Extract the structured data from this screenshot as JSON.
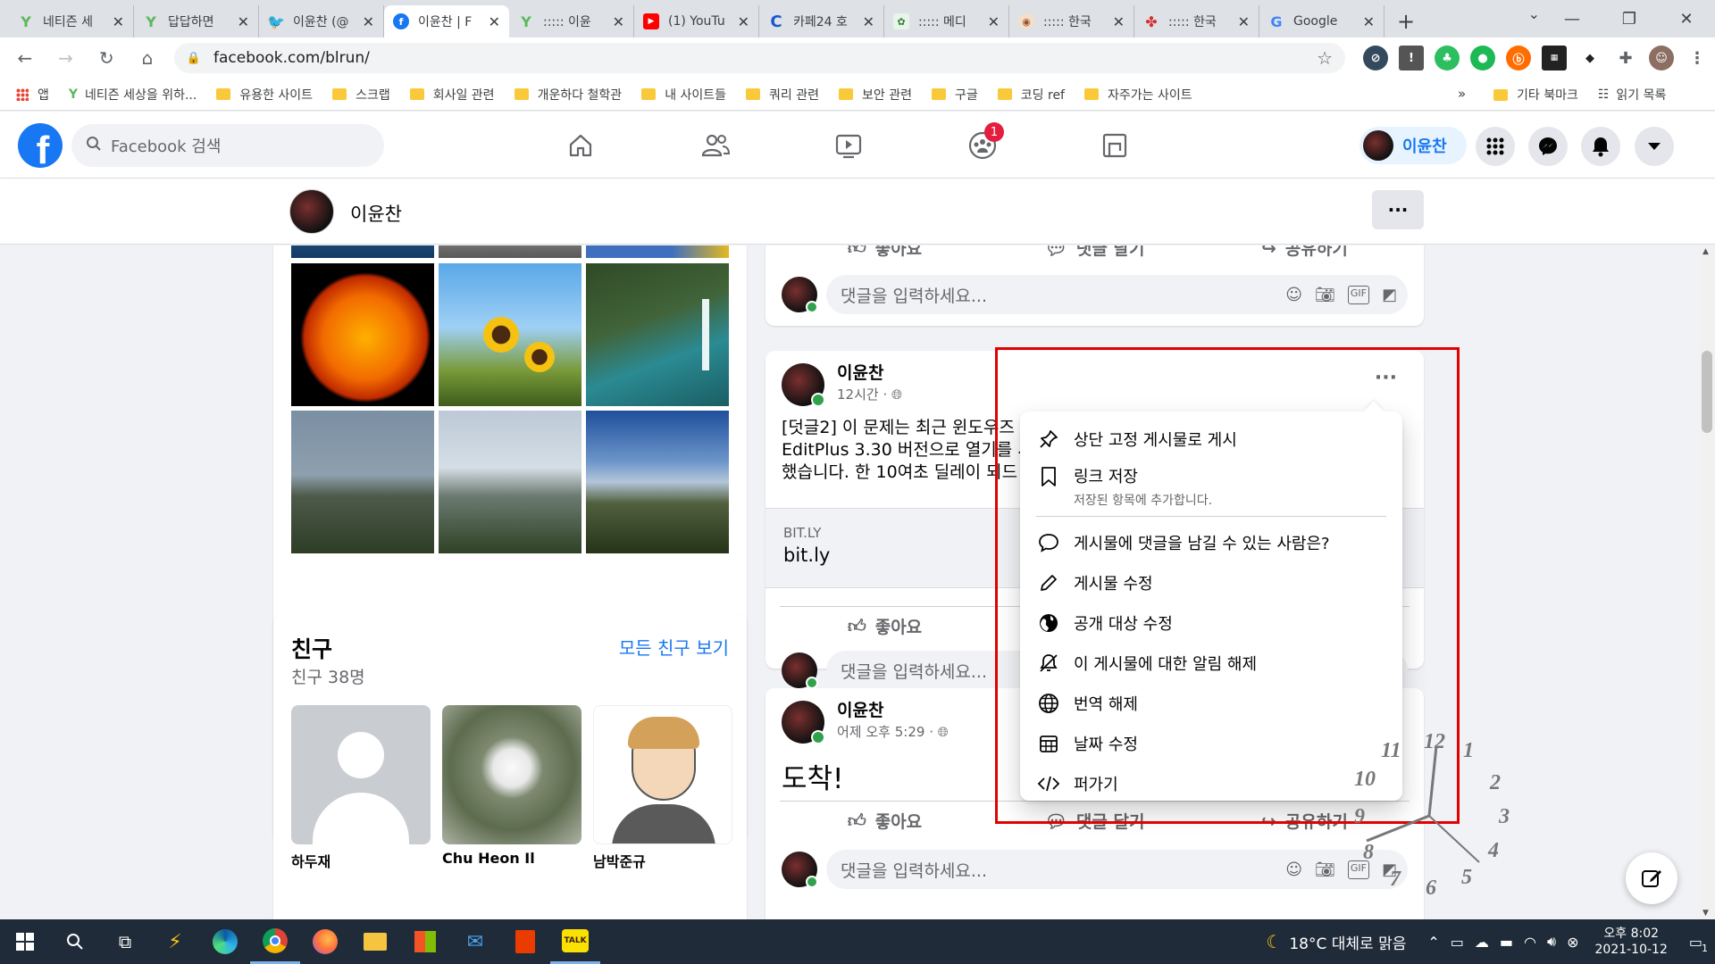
{
  "browser": {
    "tabs": [
      {
        "label": "네티즌 세",
        "icon": "sprout",
        "color": "#5cb85c",
        "active": false
      },
      {
        "label": "답답하면",
        "icon": "sprout",
        "color": "#5cb85c",
        "active": false
      },
      {
        "label": "이윤찬 (@",
        "icon": "twitter",
        "color": "#1da1f2",
        "active": false
      },
      {
        "label": "이윤찬 | F",
        "icon": "facebook",
        "color": "#1877f2",
        "active": true
      },
      {
        "label": "::::: 이윤",
        "icon": "sprout",
        "color": "#5cb85c",
        "active": false
      },
      {
        "label": "(1) YouTu",
        "icon": "youtube",
        "color": "#ff0000",
        "active": false
      },
      {
        "label": "카페24 호",
        "icon": "cafe24",
        "color": "#1a57d6",
        "active": false
      },
      {
        "label": "::::: 메디",
        "icon": "medi",
        "color": "#2e7d32",
        "active": false
      },
      {
        "label": "::::: 한국",
        "icon": "korea",
        "color": "#a0522d",
        "active": false
      },
      {
        "label": "::::: 한국",
        "icon": "korea2",
        "color": "#d32f2f",
        "active": false
      },
      {
        "label": "Google",
        "icon": "google",
        "color": "#4285f4",
        "active": false
      }
    ],
    "url": "facebook.com/blrun/",
    "bookmarks": [
      {
        "label": "앱",
        "type": "apps"
      },
      {
        "label": "네티즌 세상을 위하...",
        "type": "sprout"
      },
      {
        "label": "유용한 사이트",
        "type": "folder"
      },
      {
        "label": "스크랩",
        "type": "folder"
      },
      {
        "label": "회사일 관련",
        "type": "folder"
      },
      {
        "label": "개운하다 철학관",
        "type": "folder"
      },
      {
        "label": "내 사이트들",
        "type": "folder"
      },
      {
        "label": "쿼리 관련",
        "type": "folder"
      },
      {
        "label": "보안 관련",
        "type": "folder"
      },
      {
        "label": "구글",
        "type": "folder"
      },
      {
        "label": "코딩 ref",
        "type": "folder"
      },
      {
        "label": "자주가는 사이트",
        "type": "folder"
      }
    ],
    "bookmarks_more": "»",
    "other_bookmarks": "기타 북마크",
    "reading_list": "읽기 목록"
  },
  "fb": {
    "search_placeholder": "Facebook 검색",
    "notif_count": "1",
    "profile_name": "이윤찬"
  },
  "profile_bar": {
    "name": "이윤찬",
    "more": "···"
  },
  "friends": {
    "title": "친구",
    "count": "친구 38명",
    "see_all": "모든 친구 보기",
    "list": [
      {
        "name": "하두재"
      },
      {
        "name": "Chu Heon Il"
      },
      {
        "name": "남박준규"
      }
    ]
  },
  "posts": {
    "actions": {
      "like": "좋아요",
      "comment": "댓글 달기",
      "share": "공유하기"
    },
    "comment_placeholder": "댓글을 입력하세요...",
    "post1": {
      "author": "이윤찬",
      "time": "12시간 ·",
      "text_lines": [
        "[덧글2] 이 문제는 최근 윈도우즈",
        "EditPlus 3.30 버전으로 열기를 시",
        "했습니다. 한 10여초 딜레이 되드"
      ],
      "link_domain": "BIT.LY",
      "link_title": "bit.ly"
    },
    "post2": {
      "author": "이윤찬",
      "time": "어제 오후 5:29 ·",
      "text": "도착!"
    }
  },
  "menu": {
    "items": [
      {
        "label": "상단 고정 게시물로 게시",
        "icon": "pin-icon"
      },
      {
        "label": "링크 저장",
        "sub": "저장된 항목에 추가합니다.",
        "icon": "bookmark-icon"
      },
      {
        "label": "게시물에 댓글을 남길 수 있는 사람은?",
        "icon": "comment-bubble-icon"
      },
      {
        "label": "게시물 수정",
        "icon": "pencil-icon"
      },
      {
        "label": "공개 대상 수정",
        "icon": "globe-icon"
      },
      {
        "label": "이 게시물에 대한 알림 해제",
        "icon": "bell-off-icon"
      },
      {
        "label": "번역 해제",
        "icon": "translate-icon"
      },
      {
        "label": "날짜 수정",
        "icon": "calendar-icon"
      },
      {
        "label": "퍼가기",
        "icon": "embed-code-icon"
      }
    ]
  },
  "clock_overlay": [
    "12",
    "1",
    "2",
    "3",
    "4",
    "5",
    "6",
    "7",
    "8",
    "9",
    "10",
    "11"
  ],
  "taskbar": {
    "weather": "18°C 대체로 맑음",
    "time": "오후 8:02",
    "date": "2021-10-12",
    "notif_count": "1"
  },
  "colors": {
    "fb_blue": "#1877f2",
    "highlight_red": "#e20000",
    "taskbar": "#1f2b38"
  }
}
